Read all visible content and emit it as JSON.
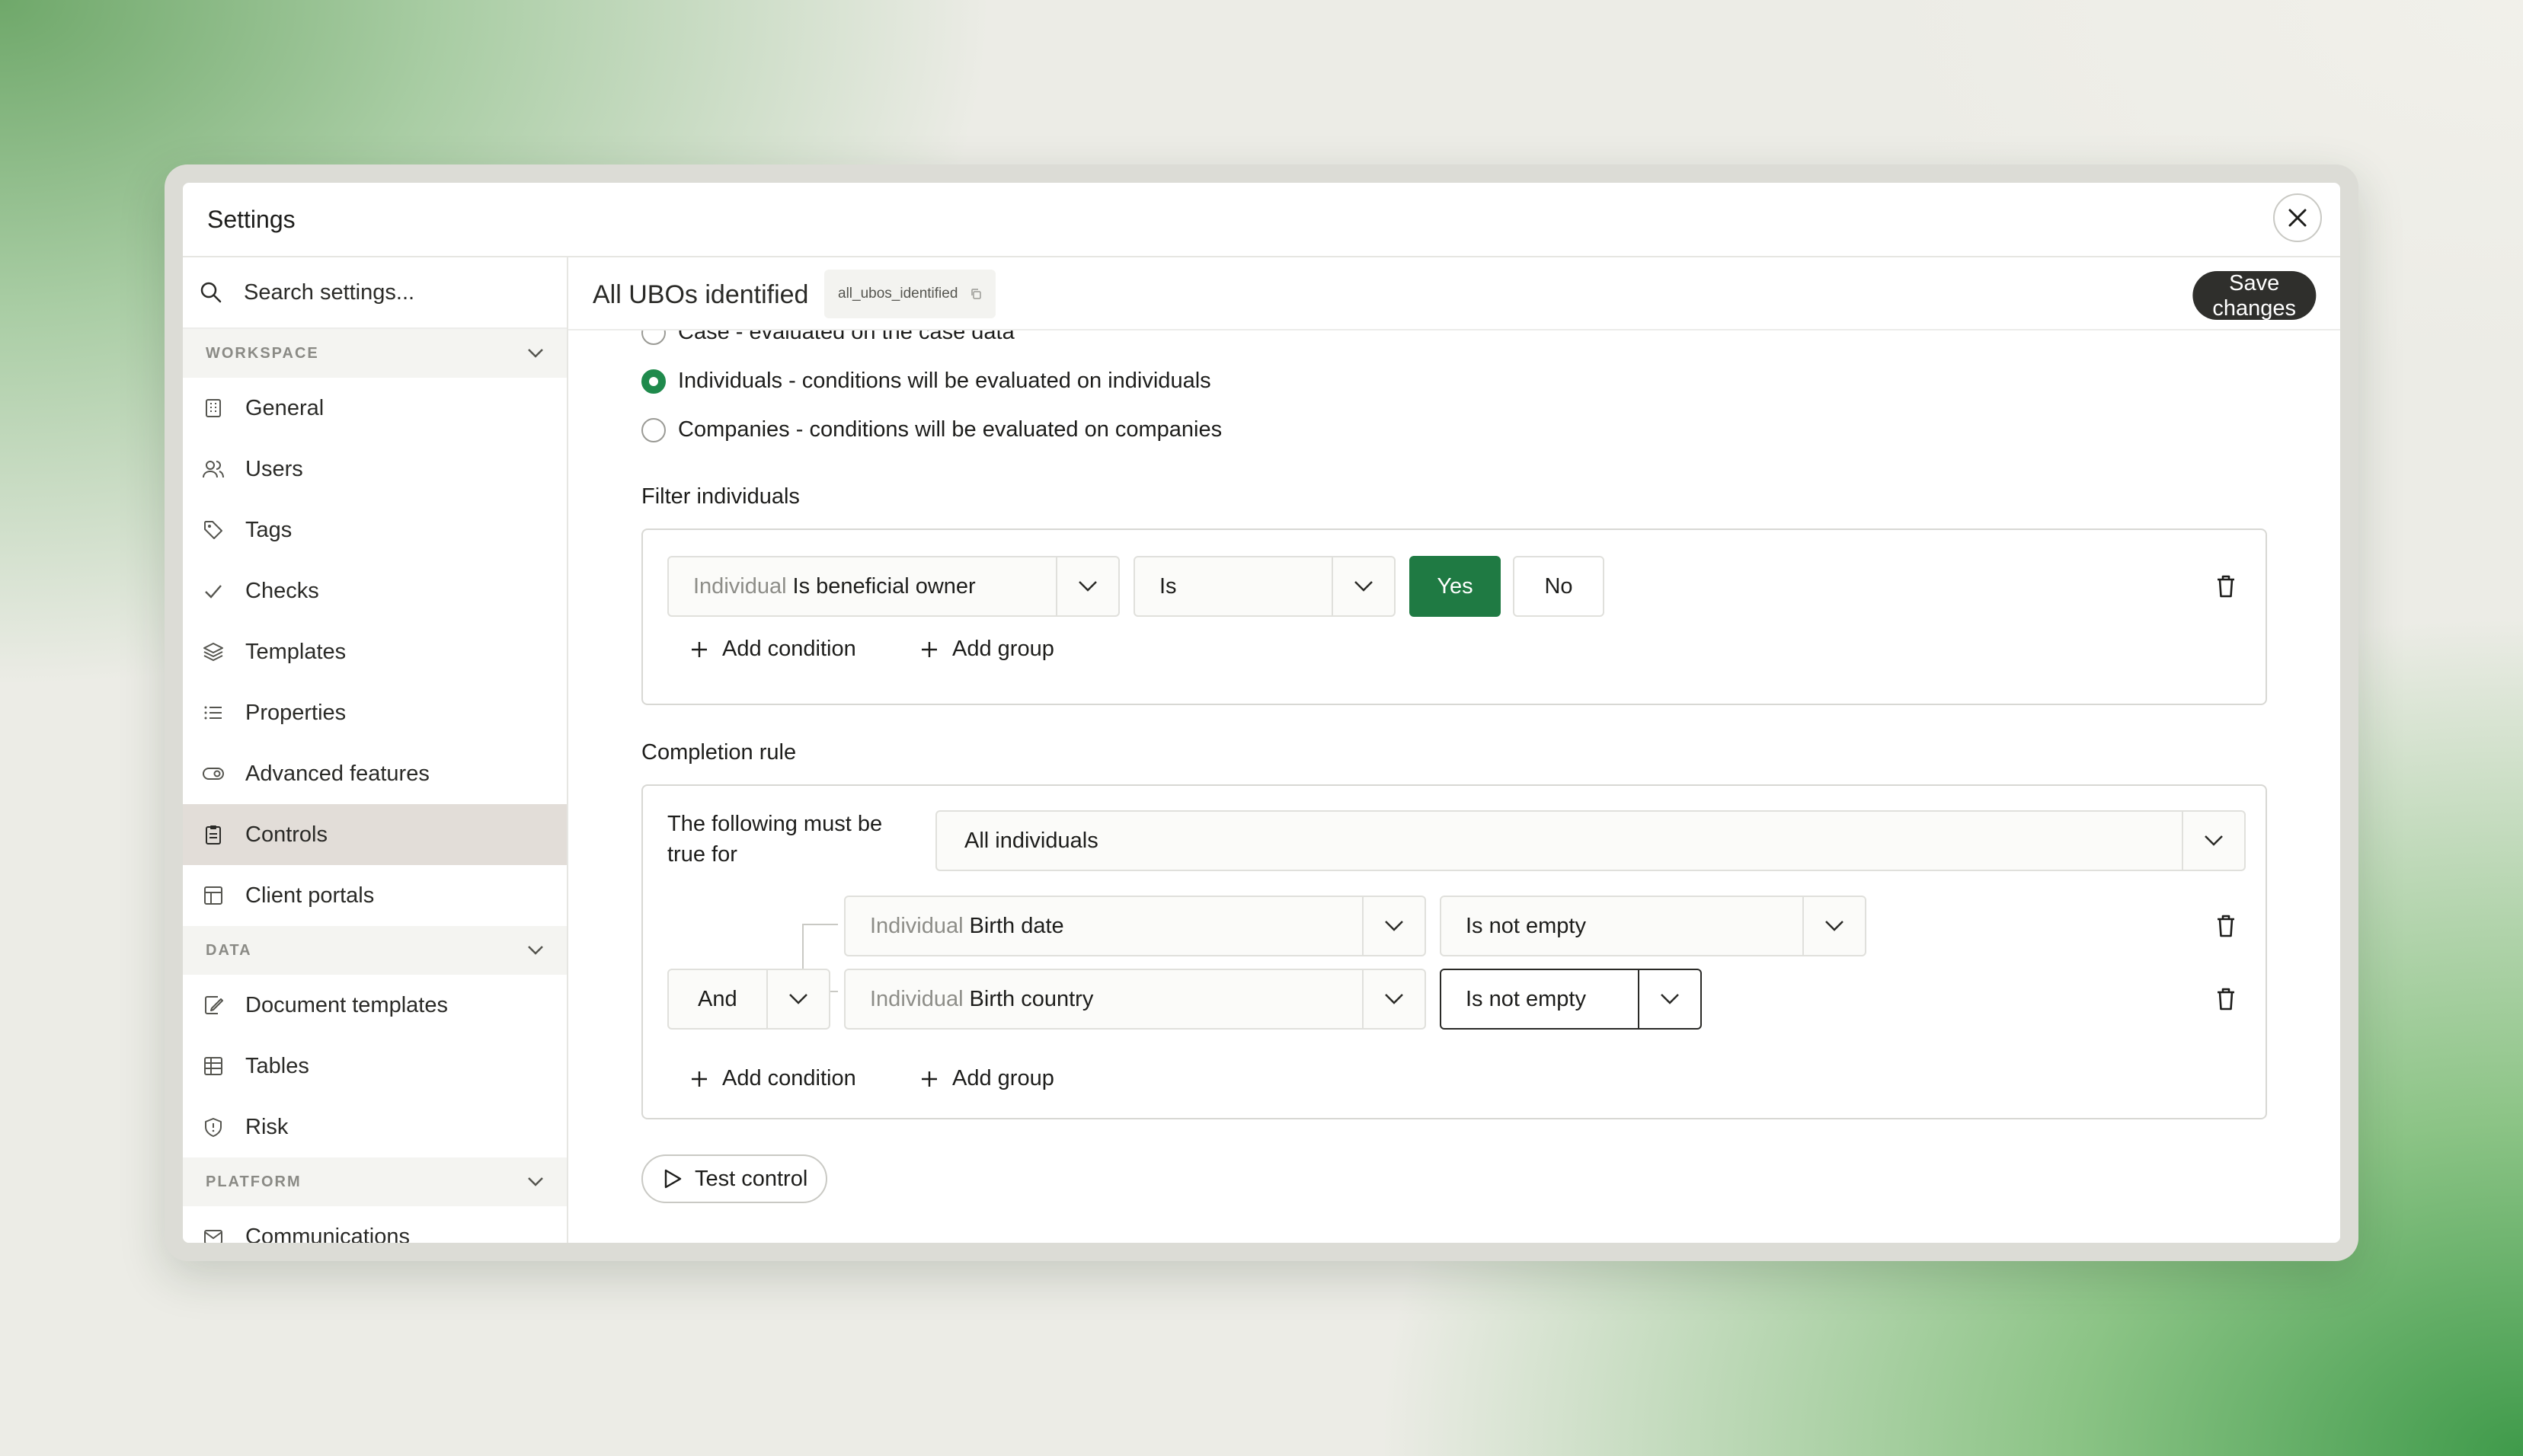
{
  "window": {
    "title": "Settings"
  },
  "sidebar": {
    "search_placeholder": "Search settings...",
    "sections": [
      {
        "label": "WORKSPACE"
      },
      {
        "label": "DATA"
      },
      {
        "label": "PLATFORM"
      }
    ],
    "workspace_items": [
      {
        "label": "General",
        "icon": "building-icon"
      },
      {
        "label": "Users",
        "icon": "users-icon"
      },
      {
        "label": "Tags",
        "icon": "tag-icon"
      },
      {
        "label": "Checks",
        "icon": "check-icon"
      },
      {
        "label": "Templates",
        "icon": "layers-icon"
      },
      {
        "label": "Properties",
        "icon": "list-icon"
      },
      {
        "label": "Advanced features",
        "icon": "toggle-icon"
      },
      {
        "label": "Controls",
        "icon": "clipboard-icon",
        "active": true
      },
      {
        "label": "Client portals",
        "icon": "layout-icon"
      }
    ],
    "data_items": [
      {
        "label": "Document templates",
        "icon": "file-edit-icon"
      },
      {
        "label": "Tables",
        "icon": "table-icon"
      },
      {
        "label": "Risk",
        "icon": "shield-icon"
      }
    ],
    "platform_items": [
      {
        "label": "Communications",
        "icon": "mail-icon"
      }
    ]
  },
  "header": {
    "control_name": "All UBOs identified",
    "slug": "all_ubos_identified",
    "save_label": "Save changes"
  },
  "scope": {
    "options": [
      {
        "label": "Case - evaluated on the case data",
        "selected": false
      },
      {
        "label": "Individuals - conditions will be evaluated on individuals",
        "selected": true
      },
      {
        "label": "Companies - conditions will be evaluated on companies",
        "selected": false
      }
    ]
  },
  "filter": {
    "label": "Filter individuals",
    "field_prefix": "Individual",
    "field_name": "Is beneficial owner",
    "operator": "Is",
    "yes_label": "Yes",
    "no_label": "No",
    "selected_value": "Yes",
    "add_condition": "Add condition",
    "add_group": "Add group"
  },
  "completion": {
    "label": "Completion rule",
    "quantifier_label": "The following must be true for",
    "quantifier_value": "All individuals",
    "conjunction": "And",
    "conditions": [
      {
        "prefix": "Individual",
        "field": "Birth date",
        "operator": "Is not empty"
      },
      {
        "prefix": "Individual",
        "field": "Birth country",
        "operator": "Is not empty"
      }
    ],
    "add_condition": "Add condition",
    "add_group": "Add group"
  },
  "test_label": "Test control",
  "colors": {
    "accent_green": "#1f7a43",
    "radio_green": "#1f8a4c",
    "active_nav": "#e2ddd8",
    "dark_button": "#2f2f2c"
  }
}
